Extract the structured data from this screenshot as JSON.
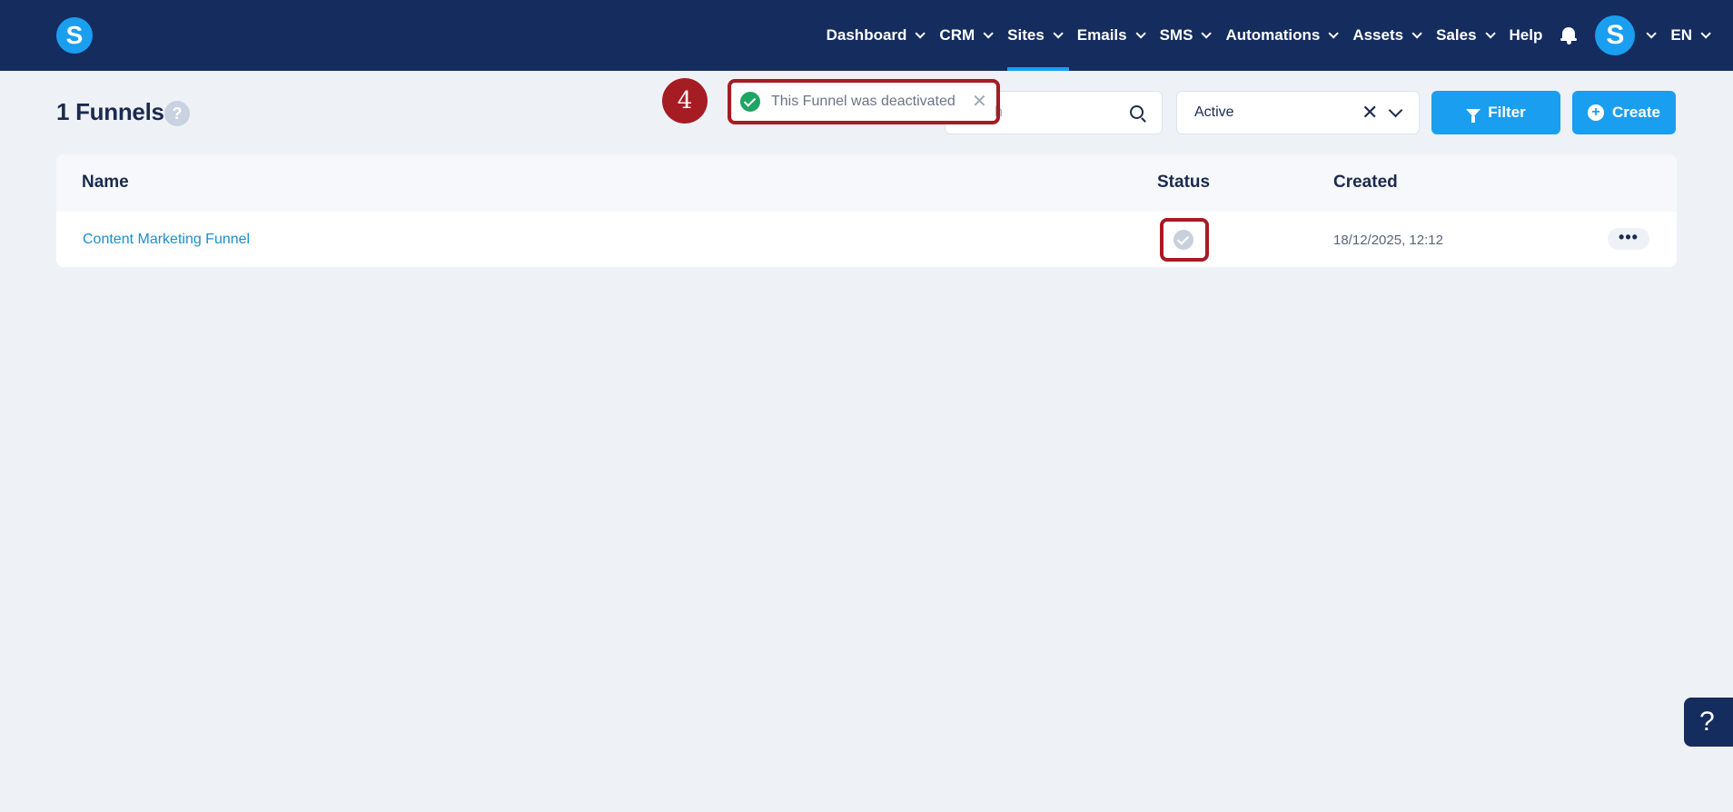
{
  "navbar": {
    "logo_letter": "S",
    "items": [
      {
        "label": "Dashboard",
        "has_dropdown": true,
        "active": false
      },
      {
        "label": "CRM",
        "has_dropdown": true,
        "active": false
      },
      {
        "label": "Sites",
        "has_dropdown": true,
        "active": true
      },
      {
        "label": "Emails",
        "has_dropdown": true,
        "active": false
      },
      {
        "label": "SMS",
        "has_dropdown": true,
        "active": false
      },
      {
        "label": "Automations",
        "has_dropdown": true,
        "active": false
      },
      {
        "label": "Assets",
        "has_dropdown": true,
        "active": false
      },
      {
        "label": "Sales",
        "has_dropdown": true,
        "active": false
      },
      {
        "label": "Help",
        "has_dropdown": false,
        "active": false
      }
    ],
    "avatar_letter": "S",
    "language": "EN"
  },
  "page": {
    "title": "1 Funnels",
    "help_icon_glyph": "?"
  },
  "search": {
    "placeholder_visible": "h"
  },
  "status_filter": {
    "value": "Active",
    "clear_glyph": "✕"
  },
  "buttons": {
    "filter_label": "Filter",
    "create_label": "Create"
  },
  "table": {
    "columns": [
      "Name",
      "Status",
      "Created"
    ],
    "rows": [
      {
        "name": "Content Marketing Funnel",
        "status_active": false,
        "created": "18/12/2025, 12:12",
        "more": "•••"
      }
    ]
  },
  "toast": {
    "message": "This Funnel was deactivated",
    "close_glyph": "✕"
  },
  "annotation": {
    "step_number": "4",
    "color": "#a61c23"
  },
  "help_fab": {
    "glyph": "?"
  },
  "colors": {
    "navbar": "#152c5e",
    "accent": "#1a9ef0",
    "success": "#1fa463",
    "background": "#eef2f7"
  }
}
